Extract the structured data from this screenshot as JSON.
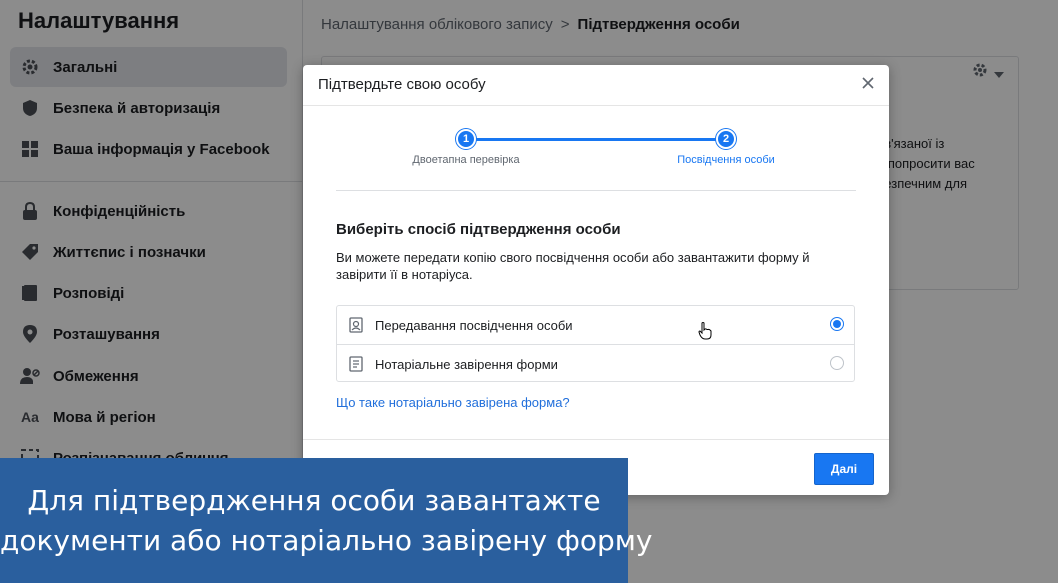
{
  "sidebar": {
    "title": "Налаштування",
    "items": [
      {
        "label": "Загальні",
        "icon": "gear-icon",
        "active": true
      },
      {
        "label": "Безпека й авторизація",
        "icon": "shield-icon"
      },
      {
        "label": "Ваша інформація у Facebook",
        "icon": "grid-icon"
      },
      {
        "label": "Конфіденційність",
        "icon": "lock-icon"
      },
      {
        "label": "Життєпис і позначки",
        "icon": "tag-icon"
      },
      {
        "label": "Розповіді",
        "icon": "book-icon"
      },
      {
        "label": "Розташування",
        "icon": "location-icon"
      },
      {
        "label": "Обмеження",
        "icon": "block-user-icon"
      },
      {
        "label": "Мова й регіон",
        "icon": "language-icon"
      },
      {
        "label": "Розпізнавання обличчя",
        "icon": "face-icon"
      }
    ]
  },
  "breadcrumb": {
    "parent": "Налаштування облікового запису",
    "separator": ">",
    "current": "Підтвердження особи"
  },
  "background_card": {
    "text_lines": [
      "ов'язаної із",
      "о попросити вас",
      "безпечним для"
    ]
  },
  "modal": {
    "title": "Підтвердьте свою особу",
    "steps": [
      {
        "number": "1",
        "label": "Двоетапна перевірка",
        "state": "done"
      },
      {
        "number": "2",
        "label": "Посвідчення особи",
        "state": "current"
      }
    ],
    "section_title": "Виберіть спосіб підтвердження особи",
    "section_desc": "Ви можете передати копію свого посвідчення особи або завантажити форму й завірити її в нотаріуса.",
    "options": [
      {
        "label": "Передавання посвідчення особи",
        "icon": "id-card-icon",
        "selected": true
      },
      {
        "label": "Нотаріальне завірення форми",
        "icon": "document-icon",
        "selected": false
      }
    ],
    "help_link": "Що таке нотаріально завірена форма?",
    "next_button": "Далі"
  },
  "caption": {
    "line1": "Для підтвердження особи завантажте",
    "line2": "документи або нотаріально завірену форму"
  },
  "colors": {
    "accent": "#1877f2",
    "caption_bg": "#2a5f9e",
    "link": "#216fdb"
  }
}
